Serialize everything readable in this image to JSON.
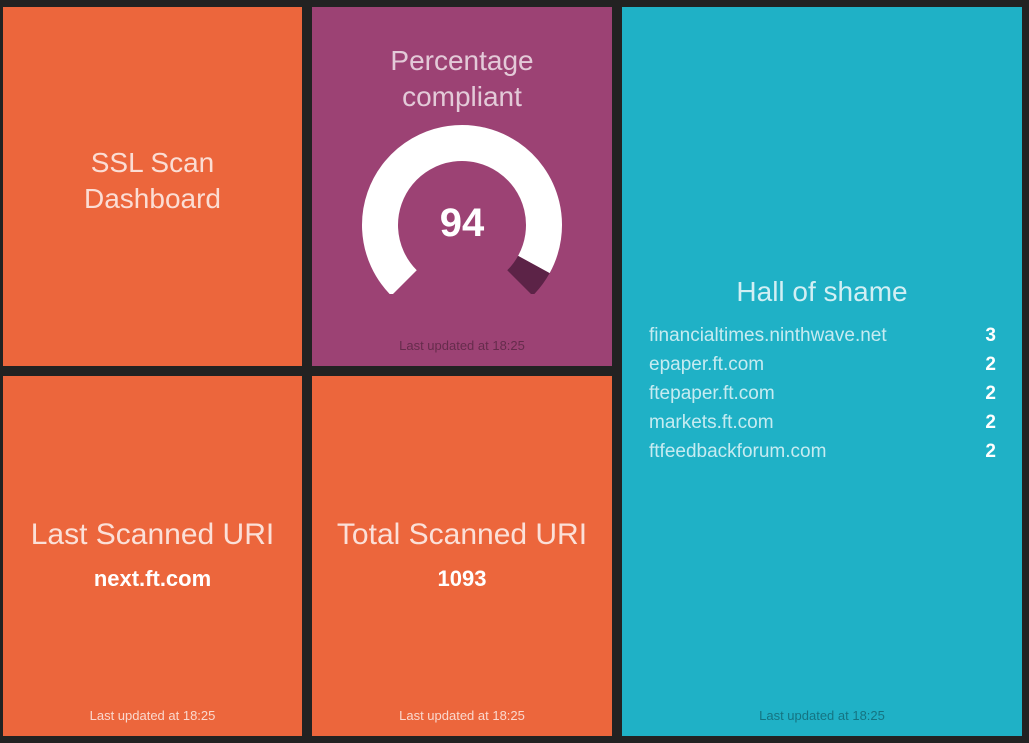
{
  "title_widget": {
    "title_line1": "SSL Scan",
    "title_line2": "Dashboard"
  },
  "compliance_widget": {
    "title_line1": "Percentage",
    "title_line2": "compliant",
    "value": "94",
    "percent": 94,
    "updated": "Last updated at 18:25",
    "colors": {
      "track": "#ffffff",
      "fill": "#5c2347"
    }
  },
  "hall_of_shame": {
    "title": "Hall of shame",
    "items": [
      {
        "label": "financialtimes.ninthwave.net",
        "value": "3"
      },
      {
        "label": "epaper.ft.com",
        "value": "2"
      },
      {
        "label": "ftepaper.ft.com",
        "value": "2"
      },
      {
        "label": "markets.ft.com",
        "value": "2"
      },
      {
        "label": "ftfeedbackforum.com",
        "value": "2"
      }
    ],
    "updated": "Last updated at 18:25"
  },
  "last_scanned": {
    "title": "Last Scanned URI",
    "value": "next.ft.com",
    "updated": "Last updated at 18:25"
  },
  "total_scanned": {
    "title": "Total Scanned URI",
    "value": "1093",
    "updated": "Last updated at 18:25"
  },
  "colors": {
    "background": "#222222",
    "orange": "#ec663c",
    "purple": "#9c4274",
    "teal": "#1fb1c6"
  }
}
